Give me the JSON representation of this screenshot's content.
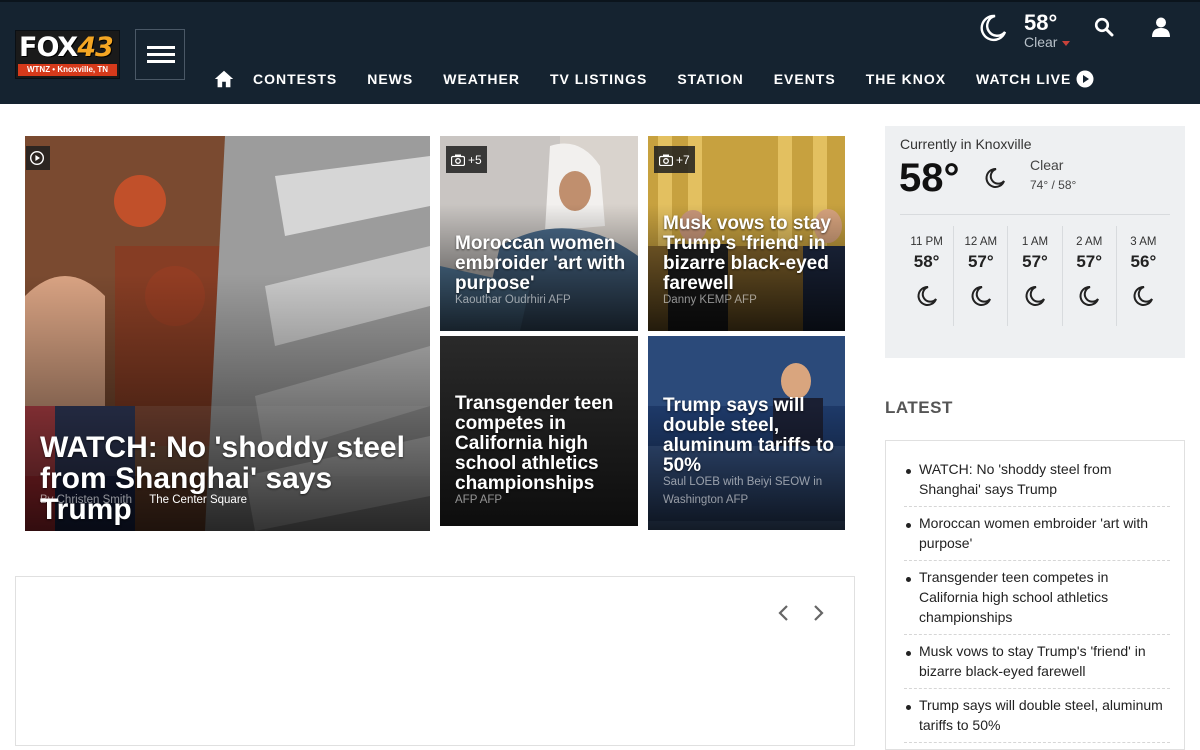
{
  "header": {
    "logo_text": "FOX43",
    "logo_fox": "FOX",
    "logo_num": "43",
    "logo_strip": "WTNZ • Knoxville, TN",
    "nav_items": [
      "CONTESTS",
      "NEWS",
      "WEATHER",
      "TV LISTINGS",
      "STATION",
      "EVENTS",
      "THE KNOX"
    ],
    "watch_live": "WATCH LIVE",
    "weather": {
      "temp": "58°",
      "condition": "Clear"
    }
  },
  "stories": {
    "hero": {
      "headline": "WATCH: No 'shoddy steel from Shanghai' says Trump",
      "byline": "By Christen Smith",
      "source": "The Center Square"
    },
    "s1": {
      "headline": "Moroccan women embroider 'art with purpose'",
      "byline": "Kaouthar Oudrhiri AFP",
      "photos": "+5"
    },
    "s2": {
      "headline": "Musk vows to stay Trump's 'friend' in bizarre black-eyed farewell",
      "byline": "Danny KEMP AFP",
      "photos": "+7"
    },
    "s3": {
      "headline": "Transgender teen competes in California high school athletics championships",
      "byline": "AFP AFP"
    },
    "s4": {
      "headline": "Trump says will double steel, aluminum tariffs to 50%",
      "byline1": "Saul LOEB with Beiyi SEOW in",
      "byline2": "Washington AFP"
    }
  },
  "sidebar": {
    "location": "Currently in Knoxville",
    "temp": "58°",
    "condition": "Clear",
    "hilo": "74° / 58°",
    "hourly": [
      {
        "time": "11 PM",
        "temp": "58°"
      },
      {
        "time": "12 AM",
        "temp": "57°"
      },
      {
        "time": "1 AM",
        "temp": "57°"
      },
      {
        "time": "2 AM",
        "temp": "57°"
      },
      {
        "time": "3 AM",
        "temp": "56°"
      }
    ],
    "latest_title": "LATEST",
    "latest": [
      "WATCH: No 'shoddy steel from Shanghai' says Trump",
      "Moroccan women embroider 'art with purpose'",
      "Transgender teen competes in California high school athletics championships",
      "Musk vows to stay Trump's 'friend' in bizarre black-eyed farewell",
      "Trump says will double steel, aluminum tariffs to 50%"
    ]
  },
  "colors": {
    "header_bg": "#152330",
    "accent_red": "#d63a1b",
    "logo_orange": "#f5a623"
  }
}
